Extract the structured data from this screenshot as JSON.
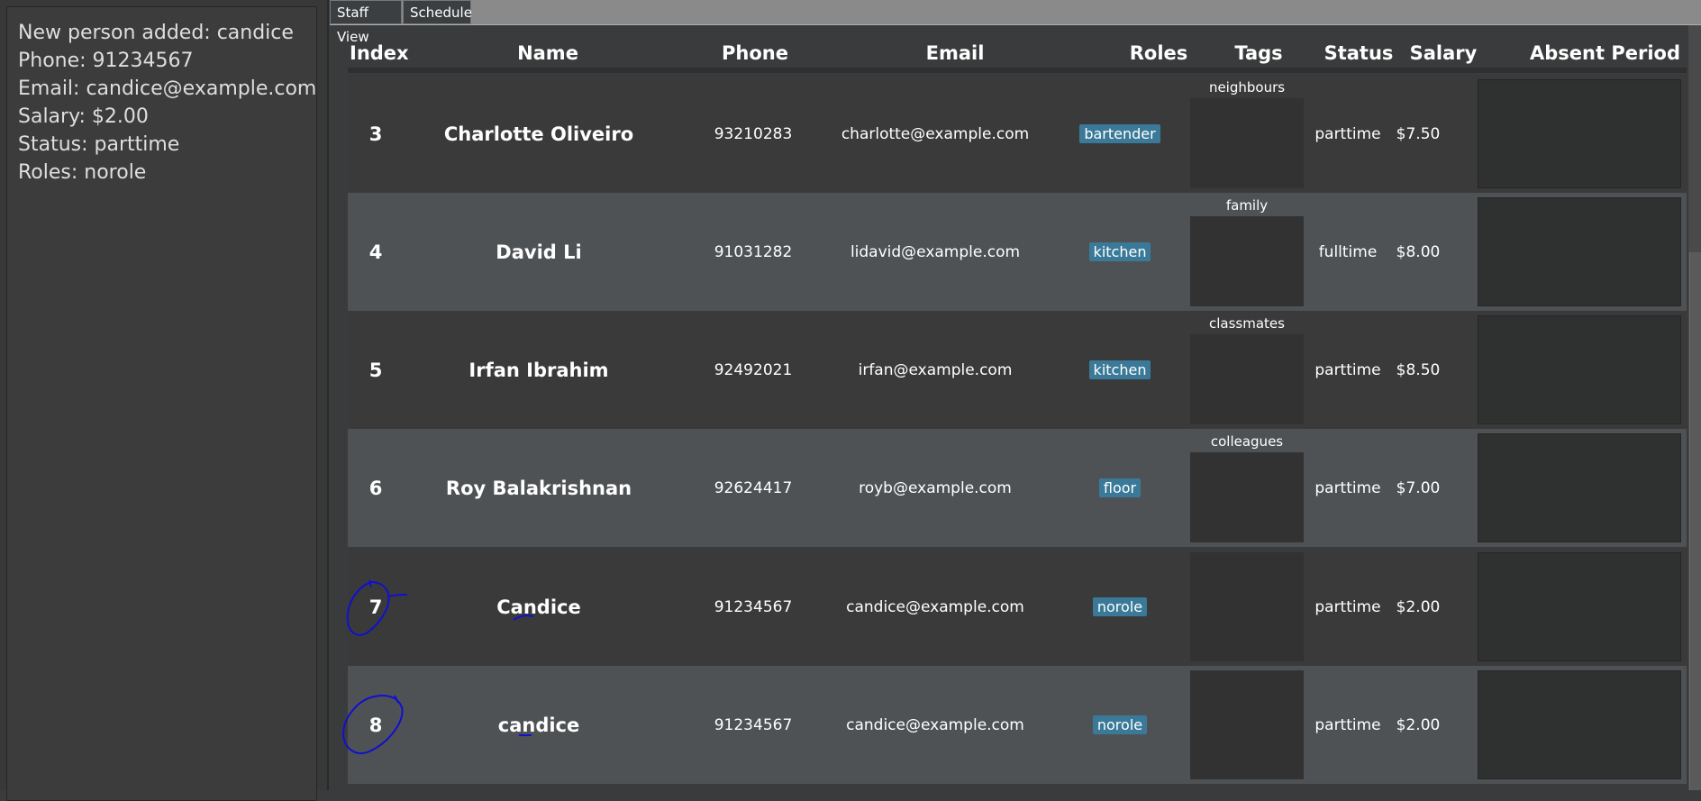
{
  "result": {
    "lines": [
      "New person added: candice",
      "Phone: 91234567",
      "Email: candice@example.com",
      "Salary: $2.00",
      "Status: parttime",
      "Roles: norole"
    ]
  },
  "tabs": {
    "staff_view": "Staff View",
    "schedule": "Schedule"
  },
  "columns": {
    "index": "Index",
    "name": "Name",
    "phone": "Phone",
    "email": "Email",
    "roles": "Roles",
    "tags": "Tags",
    "status": "Status",
    "salary": "Salary",
    "absent_period": "Absent Period"
  },
  "rows": [
    {
      "index": "3",
      "name": "Charlotte Oliveiro",
      "phone": "93210283",
      "email": "charlotte@example.com",
      "role": "bartender",
      "tag": "neighbours",
      "status": "parttime",
      "salary": "$7.50"
    },
    {
      "index": "4",
      "name": "David Li",
      "phone": "91031282",
      "email": "lidavid@example.com",
      "role": "kitchen",
      "tag": "family",
      "status": "fulltime",
      "salary": "$8.00"
    },
    {
      "index": "5",
      "name": "Irfan Ibrahim",
      "phone": "92492021",
      "email": "irfan@example.com",
      "role": "kitchen",
      "tag": "classmates",
      "status": "parttime",
      "salary": "$8.50"
    },
    {
      "index": "6",
      "name": "Roy Balakrishnan",
      "phone": "92624417",
      "email": "royb@example.com",
      "role": "floor",
      "tag": "colleagues",
      "status": "parttime",
      "salary": "$7.00"
    },
    {
      "index": "7",
      "name": "Candice",
      "phone": "91234567",
      "email": "candice@example.com",
      "role": "norole",
      "tag": "",
      "status": "parttime",
      "salary": "$2.00"
    },
    {
      "index": "8",
      "name": "candice",
      "phone": "91234567",
      "email": "candice@example.com",
      "role": "norole",
      "tag": "",
      "status": "parttime",
      "salary": "$2.00"
    }
  ],
  "colors": {
    "role_badge": "#3a7a98",
    "annotation_ink": "#1010d0"
  }
}
